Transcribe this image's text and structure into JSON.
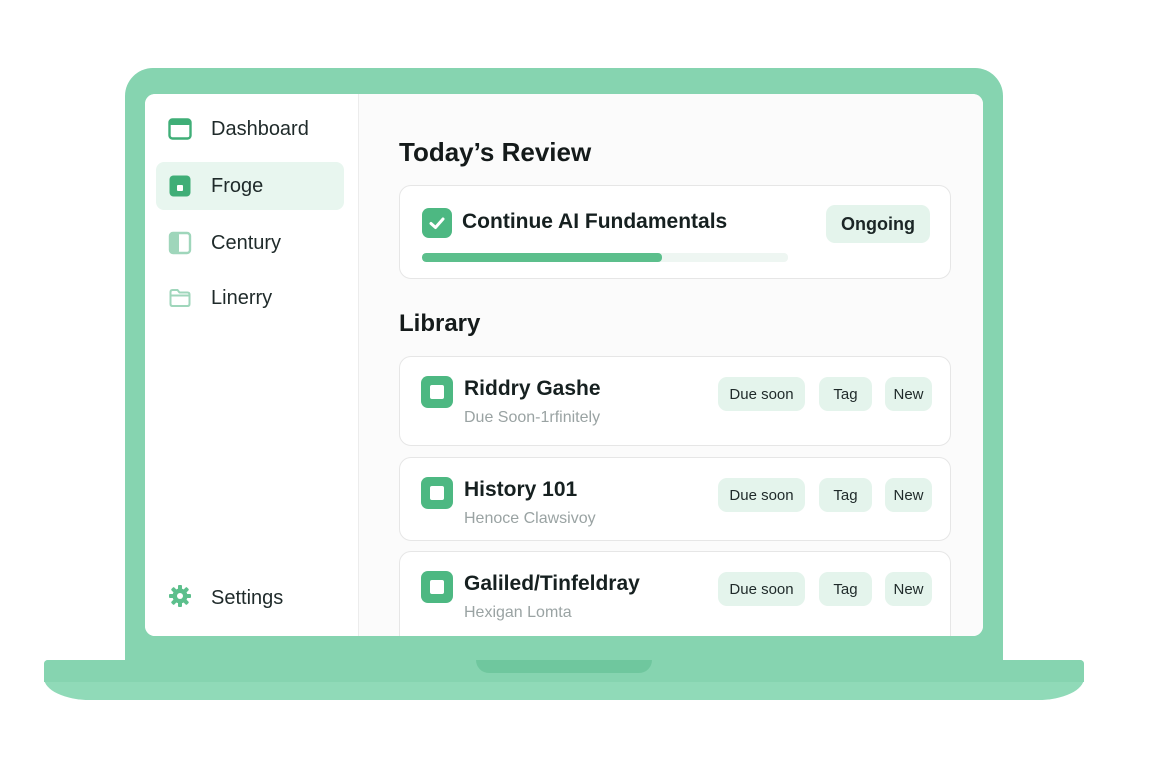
{
  "sidebar": {
    "items": [
      {
        "label": "Dashboard",
        "icon": "window-icon"
      },
      {
        "label": "Froge",
        "icon": "square-icon",
        "active": true
      },
      {
        "label": "Century",
        "icon": "panel-icon"
      },
      {
        "label": "Linerry",
        "icon": "folder-icon"
      }
    ],
    "settings_label": "Settings"
  },
  "main": {
    "review_title": "Today’s Review",
    "review": {
      "title": "Continue AI Fundamentals",
      "badge": "Ongoing",
      "progress": 0.655
    },
    "library_title": "Library",
    "library": [
      {
        "title": "Riddry Gashe",
        "subtitle": "Due Soon-1rfinitely",
        "tags": [
          "Due soon",
          "Tag",
          "New"
        ]
      },
      {
        "title": "History 101",
        "subtitle": "Henoce Clawsivoy",
        "tags": [
          "Due soon",
          "Tag",
          "New"
        ]
      },
      {
        "title": "Galiled/Tinfeldray",
        "subtitle": "Hexigan Lomta",
        "tags": [
          "Due soon",
          "Tag",
          "New"
        ]
      }
    ]
  },
  "colors": {
    "accent": "#4db882",
    "laptop": "#86d4b0",
    "badge_bg": "#e4f4ec",
    "active_nav_bg": "#e8f6ef"
  }
}
